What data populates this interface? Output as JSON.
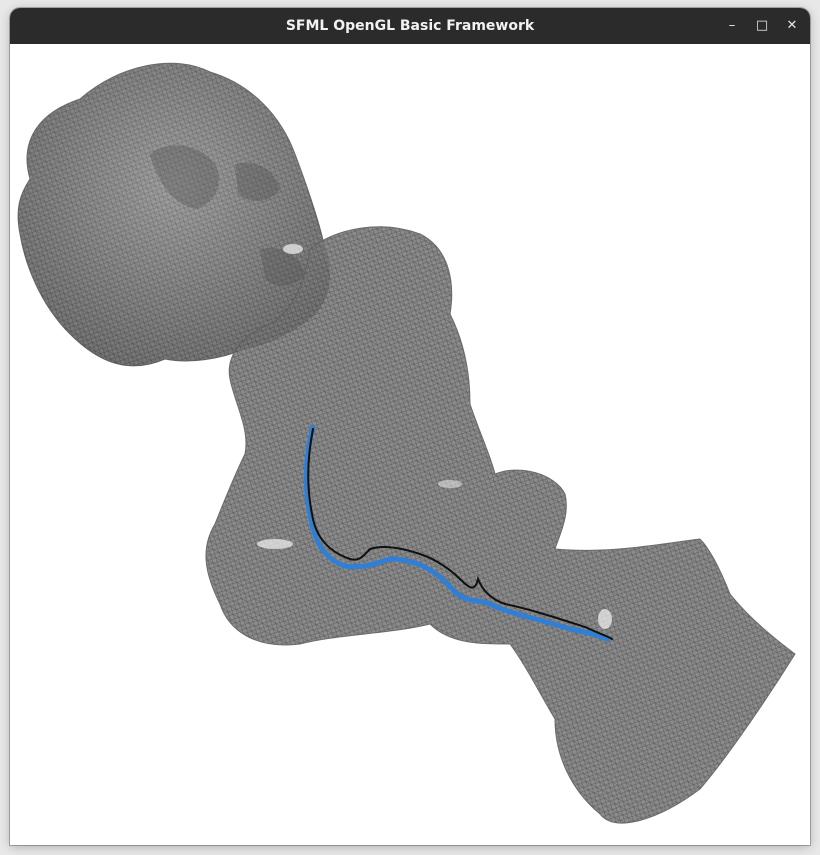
{
  "window": {
    "title": "SFML OpenGL Basic Framework",
    "controls": {
      "minimize_glyph": "–",
      "maximize_glyph": "□",
      "close_glyph": "✕"
    }
  },
  "scene": {
    "background_color": "#ffffff",
    "mesh_color": "#8a8a8a",
    "mesh_wire_color": "#555555",
    "highlight_color": "#f4f4f4",
    "path_colors": {
      "blue": "#2f7fd6",
      "black": "#111111"
    }
  }
}
